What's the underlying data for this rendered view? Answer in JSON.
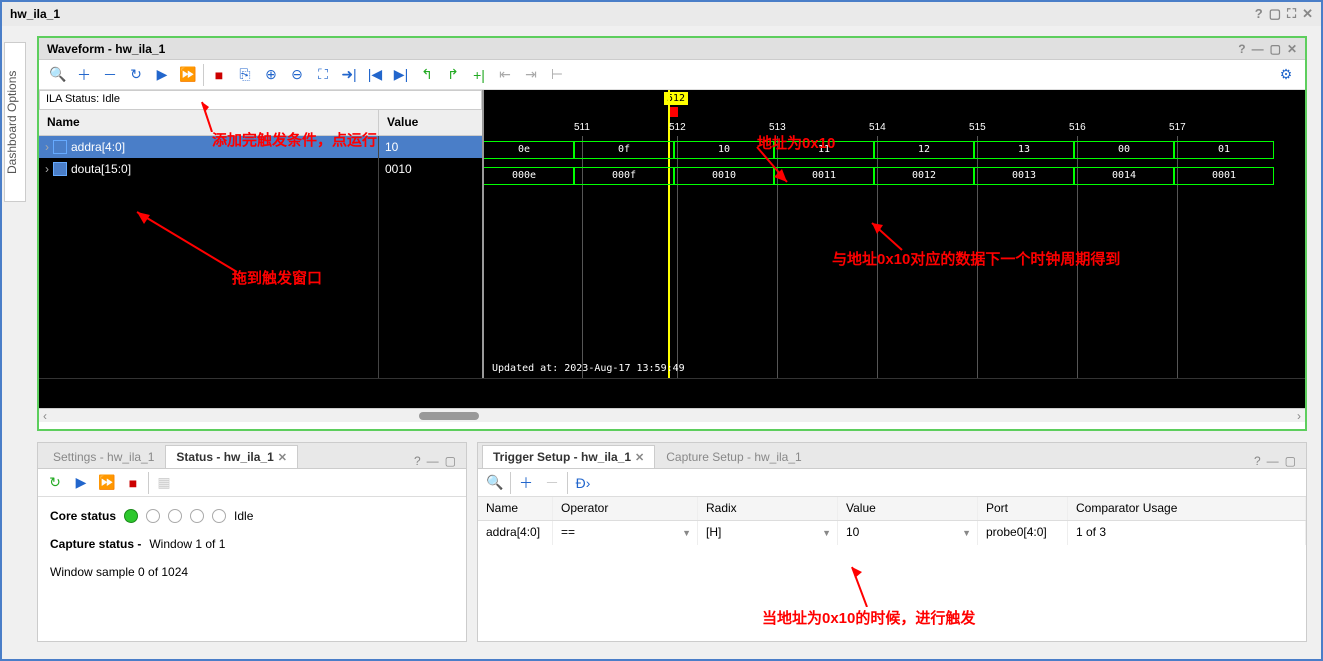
{
  "window": {
    "title": "hw_ila_1"
  },
  "sidebar": {
    "label": "Dashboard Options"
  },
  "waveform": {
    "title": "Waveform - hw_ila_1",
    "ila_status": "ILA Status: Idle",
    "headers": {
      "name": "Name",
      "value": "Value"
    },
    "signals": [
      {
        "name": "addra[4:0]",
        "value": "10"
      },
      {
        "name": "douta[15:0]",
        "value": "0010"
      }
    ],
    "trigger_pos": "512",
    "ticks": [
      "511",
      "512",
      "513",
      "514",
      "515",
      "516",
      "517"
    ],
    "bus_addra": [
      "0e",
      "0f",
      "10",
      "11",
      "12",
      "13",
      "00",
      "01"
    ],
    "bus_douta": [
      "000e",
      "000f",
      "0010",
      "0011",
      "0012",
      "0013",
      "0014",
      "0001"
    ],
    "updated": "Updated at: 2023-Aug-17 13:59:49"
  },
  "status_panel": {
    "tabs": {
      "settings": "Settings - hw_ila_1",
      "status": "Status - hw_ila_1"
    },
    "core_status_label": "Core status",
    "core_status_value": "Idle",
    "capture_status_label": "Capture status -",
    "capture_status_value": "Window 1 of 1",
    "window_sample": "Window sample 0 of 1024"
  },
  "trigger_panel": {
    "tabs": {
      "trigger": "Trigger Setup - hw_ila_1",
      "capture": "Capture Setup - hw_ila_1"
    },
    "headers": {
      "name": "Name",
      "operator": "Operator",
      "radix": "Radix",
      "value": "Value",
      "port": "Port",
      "comp": "Comparator Usage"
    },
    "row": {
      "name": "addra[4:0]",
      "operator": "==",
      "radix": "[H]",
      "value": "10",
      "port": "probe0[4:0]",
      "comp": "1 of 3"
    }
  },
  "annotations": {
    "a1": "添加完触发条件，点运行",
    "a2": "拖到触发窗口",
    "a3": "地址为0x10",
    "a4": "与地址0x10对应的数据下一个时钟周期得到",
    "a5": "当地址为0x10的时候，进行触发"
  }
}
